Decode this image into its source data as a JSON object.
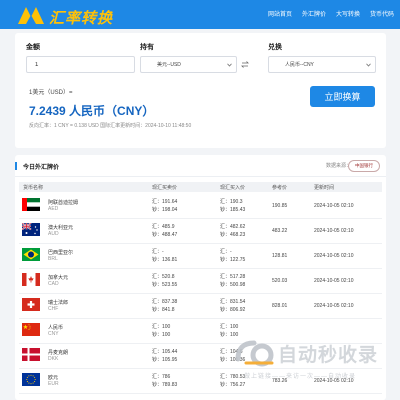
{
  "header": {
    "logo_text": "汇率转换",
    "nav": [
      "网站首页",
      "外汇牌价",
      "大写转换",
      "货币代码"
    ]
  },
  "converter": {
    "amount_label": "金额",
    "amount_value": "1",
    "have_label": "持有",
    "have_value": "美元--USD",
    "exchange_label": "兑换",
    "exchange_value": "人民币--CNY",
    "swap_icon": "swap-icon",
    "unit_line": "1美元（USD）=",
    "result": "7.2439 人民币（CNY）",
    "meta": "反向汇率：1 CNY = 0.138 USD    国际汇率更新时间：2024-10-10 11:48:50",
    "button_label": "立即换算"
  },
  "rates": {
    "title": "今日外汇牌价",
    "source_label": "数据来源：",
    "bank_logo_text": "中国银行",
    "headers": [
      "货币名称",
      "现汇买卖价",
      "现汇买入价",
      "参考价",
      "更新时间"
    ],
    "rows": [
      {
        "name": "阿联酋迪拉姆",
        "code": "AED",
        "flag": "ae",
        "bank1": "汇：191.64",
        "bank2": "钞：198.04",
        "mid1": "汇：190.3",
        "mid2": "钞：185.43",
        "ref": "190.85",
        "time": "2024-10-05 02:10"
      },
      {
        "name": "澳大利亚元",
        "code": "AUD",
        "flag": "au",
        "bank1": "汇：485.9",
        "bank2": "钞：488.47",
        "mid1": "汇：482.62",
        "mid2": "钞：468.23",
        "ref": "483.22",
        "time": "2024-10-05 02:10"
      },
      {
        "name": "巴西里亚尔",
        "code": "BRL",
        "flag": "br",
        "bank1": "汇：-",
        "bank2": "钞：136.81",
        "mid1": "汇：-",
        "mid2": "钞：122.75",
        "ref": "128.81",
        "time": "2024-10-05 02:10"
      },
      {
        "name": "加拿大元",
        "code": "CAD",
        "flag": "ca",
        "bank1": "汇：520.8",
        "bank2": "钞：523.55",
        "mid1": "汇：517.28",
        "mid2": "钞：500.98",
        "ref": "520.03",
        "time": "2024-10-05 02:10"
      },
      {
        "name": "瑞士法郎",
        "code": "CHF",
        "flag": "ch",
        "bank1": "汇：837.38",
        "bank2": "钞：841.8",
        "mid1": "汇：831.54",
        "mid2": "钞：806.92",
        "ref": "828.01",
        "time": "2024-10-05 02:10"
      },
      {
        "name": "人民币",
        "code": "CNY",
        "flag": "cn",
        "bank1": "汇：100",
        "bank2": "钞：100",
        "mid1": "汇：100",
        "mid2": "钞：100",
        "ref": "",
        "time": ""
      },
      {
        "name": "丹麦克朗",
        "code": "DKK",
        "flag": "dk",
        "bank1": "汇：105.44",
        "bank2": "钞：105.95",
        "mid1": "汇：104.6",
        "mid2": "钞：101.36",
        "ref": "",
        "time": ""
      },
      {
        "name": "欧元",
        "code": "EUR",
        "flag": "eu",
        "bank1": "汇：786",
        "bank2": "钞：789.83",
        "mid1": "汇：780.53",
        "mid2": "钞：756.27",
        "ref": "783.26",
        "time": "2024-10-05 02:10"
      }
    ]
  },
  "watermark": {
    "text": "自动秒收录",
    "slogan": "做上链接——来访一次——自动收录"
  },
  "colors": {
    "brand": "#1e88e5",
    "result": "#1565c0",
    "logo": "#ffc107"
  }
}
